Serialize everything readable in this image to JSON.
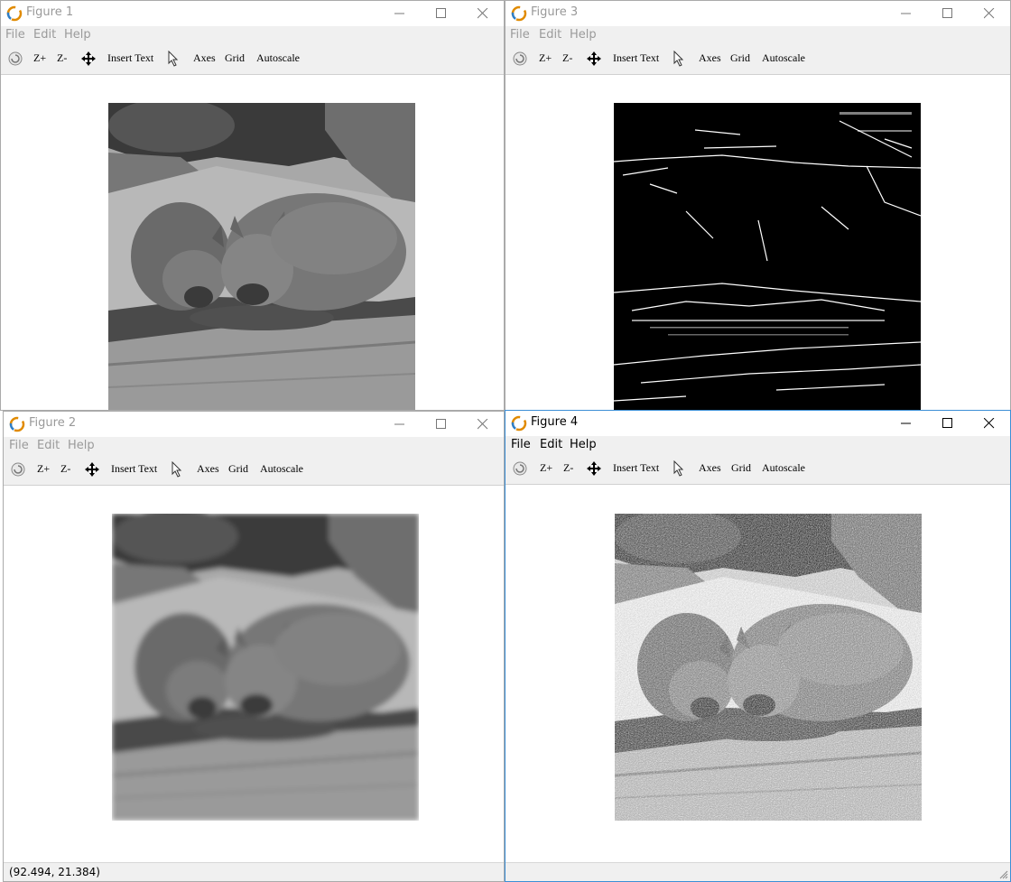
{
  "menus": [
    "File",
    "Edit",
    "Help"
  ],
  "toolbar": {
    "zoom_in": "Z+",
    "zoom_out": "Z-",
    "insert_text": "Insert Text",
    "axes": "Axes",
    "grid": "Grid",
    "autoscale": "Autoscale"
  },
  "windows": [
    {
      "title": "Figure 1",
      "image": "original grayscale photo of two wombats eating on a rock"
    },
    {
      "title": "Figure 2",
      "image": "blurred (smoothed) version of the wombat photo"
    },
    {
      "title": "Figure 3",
      "image": "binary edge map of the wombat photo, white edges on black"
    },
    {
      "title": "Figure 4",
      "image": "sharpened high-contrast version of the wombat photo"
    }
  ],
  "status": {
    "coords": "(92.494, 21.384)"
  },
  "colors": {
    "active_border": "#3c8fd6",
    "bar_bg": "#f0f0f0",
    "inactive_text": "#999999"
  }
}
